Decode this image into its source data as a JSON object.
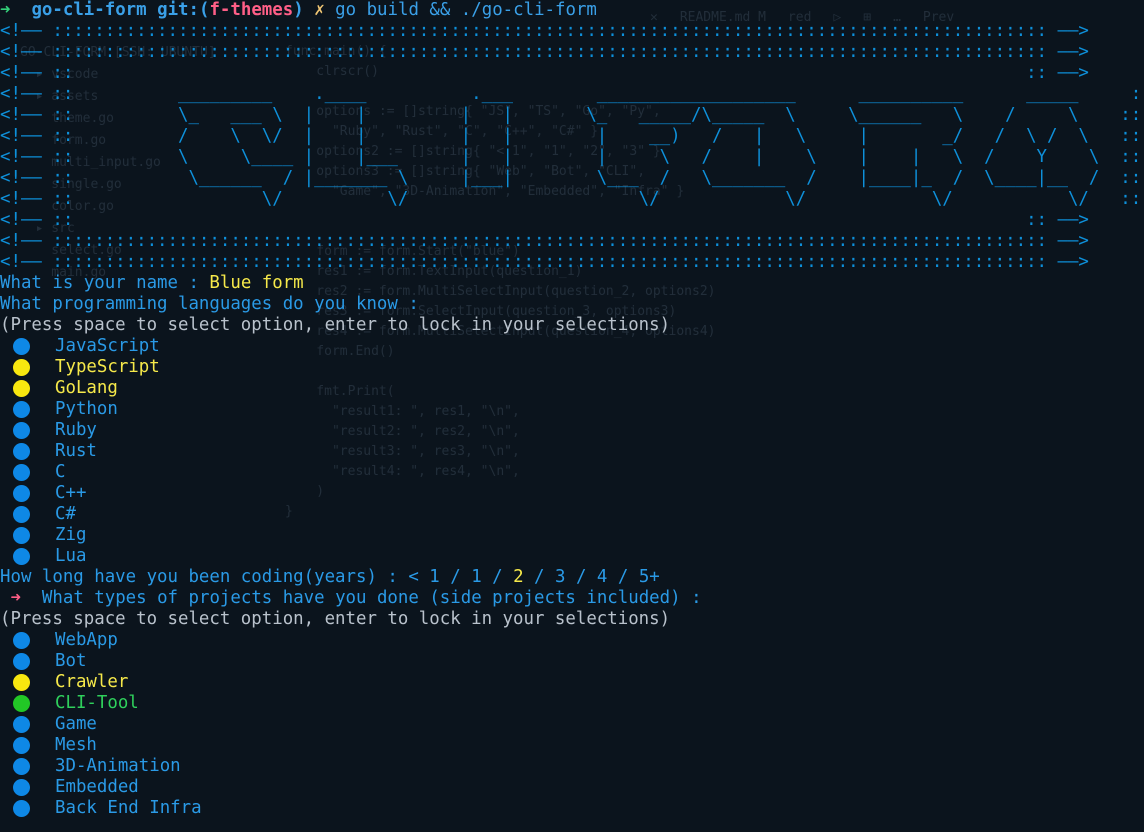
{
  "prompt": {
    "arrow": "➜",
    "cwd": "go-cli-form",
    "git_label": "git:(",
    "branch": "f-themes",
    "git_close": ")",
    "dirty_mark": "✗",
    "command": "go build && ./go-cli-form"
  },
  "banner": {
    "lines": [
      "<!—— ::::::::::::::::::::::::::::::::::::::::::::::::::::::::::::::::::::::::::::::::::::::::::::::: ——>",
      "<!—— ::::::::::::::::::::::::::::::::::::::::::::::::::::::::::::::::::::::::::::::::::::::::::::::: ——>",
      "<!—— ::                                                                                           :: ——>",
      "<!—— ::          _________    .____          .___        ___________________      __________      _____     :: ——>",
      "<!—— ::          \\_   ___ \\  |    |         |   |       \\_   _____/\\_____  \\     \\______   \\    /     \\    :: ——>",
      "<!—— ::          /    \\  \\/  |    |         |   |        |    __)   /   |   \\     |       _/   /  \\ /  \\   :: ——>",
      "<!—— ::          \\     \\____ |    |___      |   |        |     \\   /    |    \\    |    |   \\  /    Y    \\  :: ——>",
      "<!—— ::           \\______  / |_______ \\     |___|        \\___  /   \\_______  /    |____|_  /  \\____|__  /  :: ——>",
      "<!—— ::                  \\/          \\/                      \\/            \\/            \\/           \\/   :: ——>",
      "<!—— ::                                                                                           :: ——>",
      "<!—— ::::::::::::::::::::::::::::::::::::::::::::::::::::::::::::::::::::::::::::::::::::::::::::::: ——>",
      "<!—— ::::::::::::::::::::::::::::::::::::::::::::::::::::::::::::::::::::::::::::::::::::::::::::::: ——>"
    ]
  },
  "q_name": {
    "question": "What is your name : ",
    "answer": "Blue form"
  },
  "q_langs": {
    "question": "What programming languages do you know :",
    "hint": "(Press space to select option, enter to lock in your selections)",
    "options": [
      {
        "label": "JavaScript",
        "state": "blue"
      },
      {
        "label": "TypeScript",
        "state": "yellow"
      },
      {
        "label": "GoLang",
        "state": "yellow"
      },
      {
        "label": "Python",
        "state": "blue"
      },
      {
        "label": "Ruby",
        "state": "blue"
      },
      {
        "label": "Rust",
        "state": "blue"
      },
      {
        "label": "C",
        "state": "blue"
      },
      {
        "label": "C++",
        "state": "blue"
      },
      {
        "label": "C#",
        "state": "blue"
      },
      {
        "label": "Zig",
        "state": "blue"
      },
      {
        "label": "Lua",
        "state": "blue"
      }
    ]
  },
  "q_years": {
    "question": "How long have you been coding(years) : ",
    "choices": [
      "< 1",
      "1",
      "2",
      "3",
      "4",
      "5+"
    ],
    "selected": "2"
  },
  "q_projects": {
    "pointer": "➜",
    "question": "What types of projects have you done (side projects included) :",
    "hint": "(Press space to select option, enter to lock in your selections)",
    "options": [
      {
        "label": "WebApp",
        "state": "blue"
      },
      {
        "label": "Bot",
        "state": "blue"
      },
      {
        "label": "Crawler",
        "state": "yellow"
      },
      {
        "label": "CLI-Tool",
        "state": "green"
      },
      {
        "label": "Game",
        "state": "blue"
      },
      {
        "label": "Mesh",
        "state": "blue"
      },
      {
        "label": "3D-Animation",
        "state": "blue"
      },
      {
        "label": "Embedded",
        "state": "blue"
      },
      {
        "label": "Back End Infra",
        "state": "blue"
      }
    ]
  },
  "colors": {
    "background": "#0b141d",
    "question": "#2a9ae6",
    "answer": "#f6e94a",
    "unselected": "#0e88e6",
    "selected": "#f8e70f",
    "cursor": "#22c726",
    "pointer": "#ff5f87"
  }
}
